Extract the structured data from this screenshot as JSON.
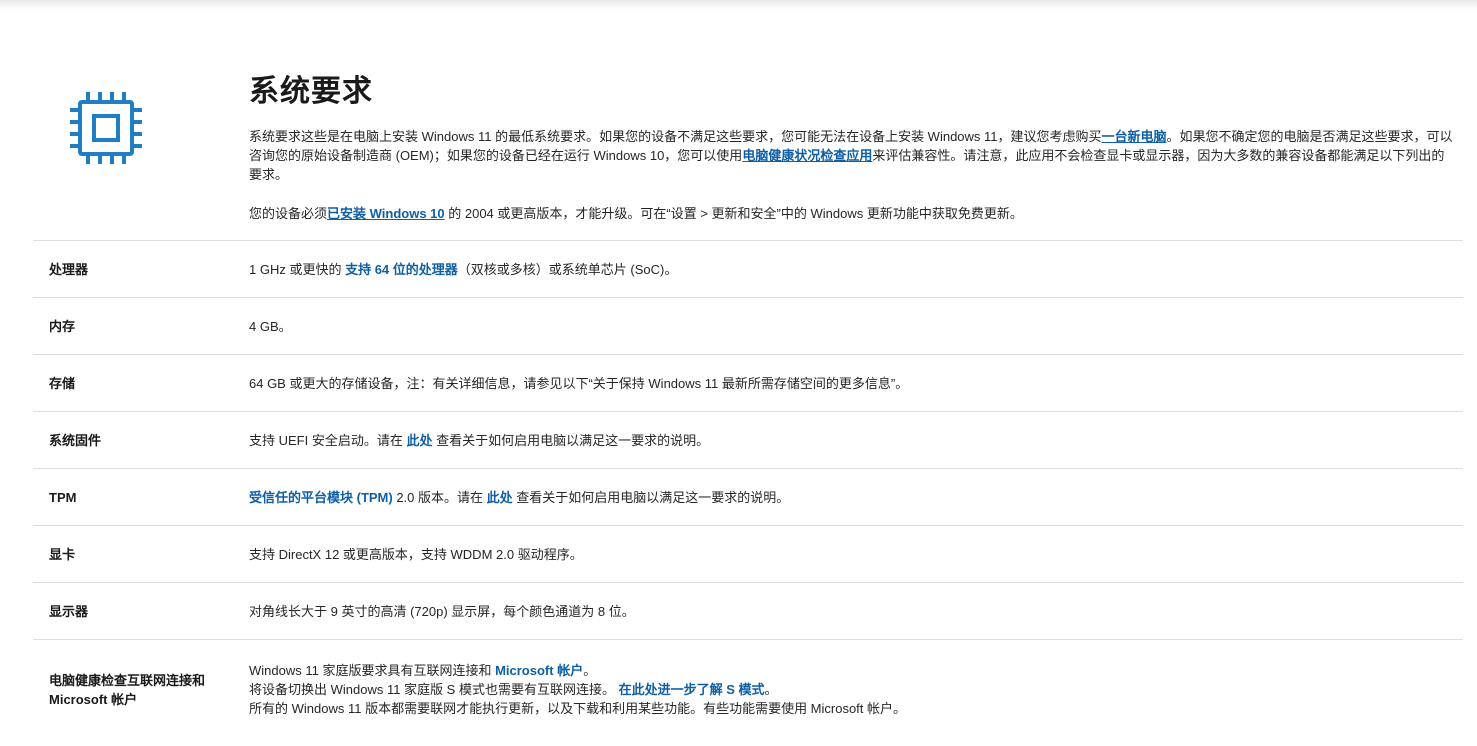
{
  "title": "系统要求",
  "intro": {
    "p1_a": "系统要求这些是在电脑上安装 Windows 11 的最低系统要求。如果您的设备不满足这些要求，您可能无法在设备上安装 Windows 11，建议您考虑购买",
    "p1_link1": "一台新电脑",
    "p1_b": "。如果您不确定您的电脑是否满足这些要求，可以咨询您的原始设备制造商 (OEM)；如果您的设备已经在运行 Windows 10，您可以使用",
    "p1_link2": "电脑健康状况检查应用",
    "p1_c": "来评估兼容性。请注意，此应用不会检查显卡或显示器，因为大多数的兼容设备都能满足以下列出的要求。",
    "p2_a": "您的设备必须",
    "p2_link": "已安装 Windows 10",
    "p2_b": " 的 2004 或更高版本，才能升级。可在“设置 > 更新和安全”中的 Windows 更新功能中获取免费更新。"
  },
  "rows": [
    {
      "label": "处理器",
      "v_a": "1 GHz 或更快的 ",
      "v_link": "支持 64 位的处理器",
      "v_b": "（双核或多核）或系统单芯片 (SoC)。"
    },
    {
      "label": "内存",
      "v_a": "4 GB。"
    },
    {
      "label": "存储",
      "v_a": "64 GB 或更大的存储设备，注：有关详细信息，请参见以下“关于保持 Windows 11 最新所需存储空间的更多信息”。"
    },
    {
      "label": "系统固件",
      "v_a": "支持 UEFI 安全启动。请在 ",
      "v_link": "此处",
      "v_b": " 查看关于如何启用电脑以满足这一要求的说明。"
    },
    {
      "label": "TPM",
      "v_link0": "受信任的平台模块 (TPM)",
      "v_a": " 2.0 版本。请在 ",
      "v_link": "此处",
      "v_b": " 查看关于如何启用电脑以满足这一要求的说明。"
    },
    {
      "label": "显卡",
      "v_a": "支持 DirectX 12 或更高版本，支持 WDDM 2.0 驱动程序。"
    },
    {
      "label": "显示器",
      "v_a": "对角线长大于 9 英寸的高清 (720p) 显示屏，每个颜色通道为 8 位。"
    },
    {
      "label": "电脑健康检查互联网连接和 Microsoft 帐户",
      "line1_a": "Windows 11 家庭版要求具有互联网连接和 ",
      "line1_link": "Microsoft 帐户",
      "line1_b": "。",
      "line2_a": "将设备切换出 Windows 11 家庭版 S 模式也需要有互联网连接。 ",
      "line2_link": "在此处进一步了解 S 模式",
      "line2_b": "。",
      "line3": "所有的 Windows 11 版本都需要联网才能执行更新，以及下载和利用某些功能。有些功能需要使用 Microsoft 帐户。"
    }
  ],
  "colors": {
    "link": "#0f5fa6",
    "icon": "#1f7ec4",
    "divider": "#dedede"
  },
  "icons": {
    "header": "cpu-chip-icon"
  }
}
